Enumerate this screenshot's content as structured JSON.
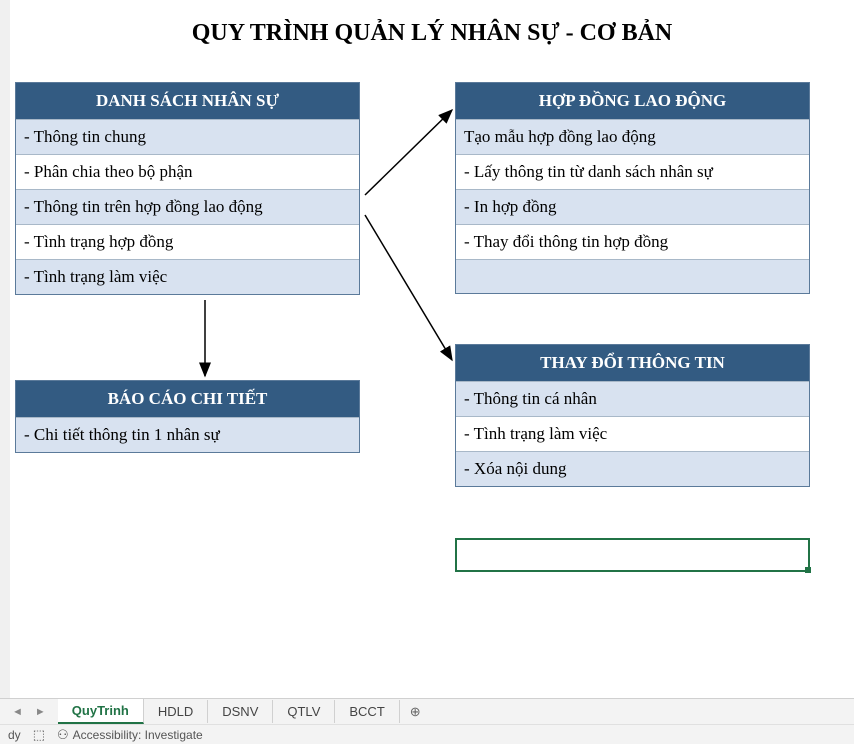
{
  "title": "QUY TRÌNH QUẢN LÝ NHÂN SỰ - CƠ BẢN",
  "box1": {
    "header": "DANH SÁCH NHÂN SỰ",
    "rows": [
      "- Thông tin chung",
      "- Phân chia theo bộ phận",
      "- Thông tin trên hợp đồng lao động",
      "- Tình trạng hợp đồng",
      "- Tình trạng làm việc"
    ]
  },
  "box2": {
    "header": "BÁO CÁO CHI TIẾT",
    "rows": [
      "- Chi tiết thông tin 1 nhân sự"
    ]
  },
  "box3": {
    "header": "HỢP ĐỒNG LAO ĐỘNG",
    "rows": [
      "Tạo mẫu hợp đồng lao động",
      "- Lấy thông tin từ danh sách nhân sự",
      "- In hợp đồng",
      "- Thay đổi thông tin hợp đồng"
    ]
  },
  "box4": {
    "header": "THAY ĐỔI THÔNG TIN",
    "rows": [
      "- Thông tin cá nhân",
      "- Tình trạng làm việc",
      "- Xóa nội dung"
    ]
  },
  "tabs": {
    "active": "QuyTrinh",
    "items": [
      "QuyTrinh",
      "HDLD",
      "DSNV",
      "QTLV",
      "BCCT"
    ]
  },
  "status": {
    "ready": "dy",
    "accessibility": "Accessibility: Investigate"
  }
}
